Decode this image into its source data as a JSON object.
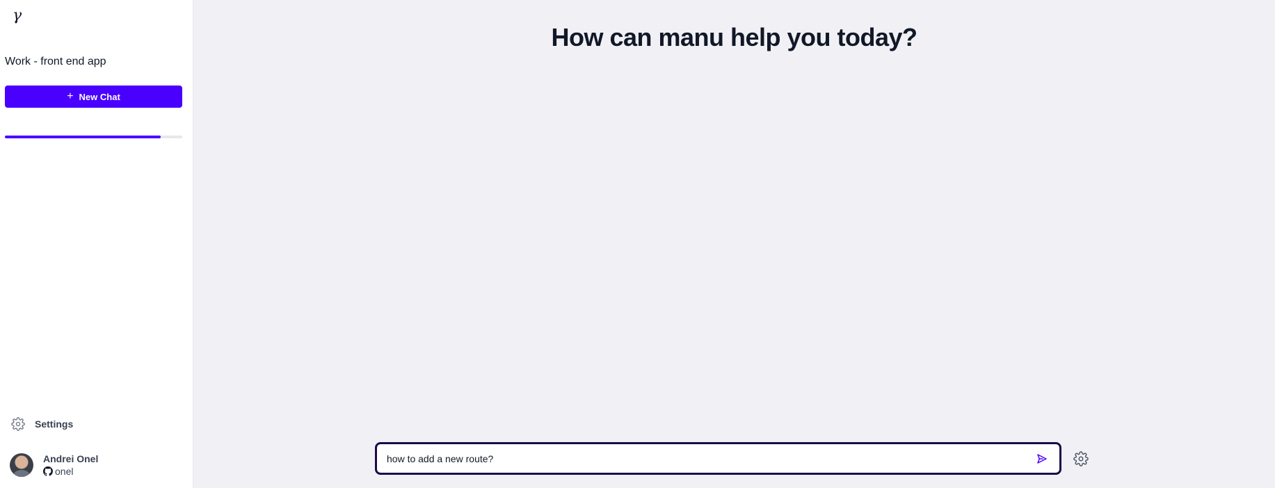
{
  "sidebar": {
    "logo": "γ",
    "project_name": "Work - front end app",
    "new_chat_label": "New Chat",
    "progress": 0.88,
    "settings_label": "Settings",
    "user": {
      "name": "Andrei Onel",
      "handle": "onel"
    }
  },
  "main": {
    "headline": "How can manu help you today?",
    "composer": {
      "value": "how to add a new route?"
    }
  },
  "colors": {
    "accent": "#4a00ff",
    "composer_border": "#1b0b4a",
    "background": "#f1f0f5"
  }
}
